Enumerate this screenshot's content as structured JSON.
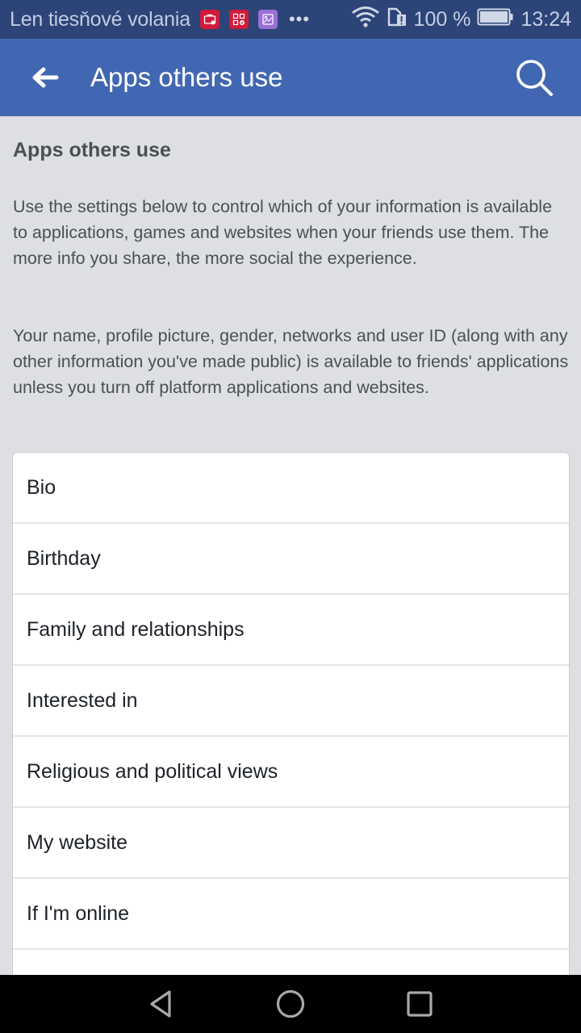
{
  "status_bar": {
    "carrier_text": "Len tiesňové volania",
    "notification_icons": [
      "briefcase-icon",
      "app-grid-check-icon",
      "gallery-icon"
    ],
    "overflow": "•••",
    "battery_percent_text": "100 %",
    "time": "13:24",
    "colors": {
      "background": "#2c4478",
      "notif_red": "#d01c3a",
      "notif_purple": "#9b6fd6"
    }
  },
  "app_bar": {
    "title": "Apps others use",
    "back_icon": "arrow-left-icon",
    "search_icon": "search-icon",
    "background": "#4267b2"
  },
  "main": {
    "heading": "Apps others use",
    "paragraphs": [
      "Use the settings below to control which of your information is available to applications, games and websites when your friends use them. The more info you share, the more social the experience.",
      "Your name, profile picture, gender, networks and user ID (along with any other information you've made public) is available to friends' applications unless you turn off platform applications and websites."
    ],
    "settings": [
      {
        "label": "Bio"
      },
      {
        "label": "Birthday"
      },
      {
        "label": "Family and relationships"
      },
      {
        "label": "Interested in"
      },
      {
        "label": "Religious and political views"
      },
      {
        "label": "My website"
      },
      {
        "label": "If I'm online"
      },
      {
        "label": ""
      }
    ],
    "background": "#dddfe2"
  },
  "nav_bar": {
    "buttons": [
      "back-triangle-icon",
      "home-circle-icon",
      "recents-square-icon"
    ]
  }
}
